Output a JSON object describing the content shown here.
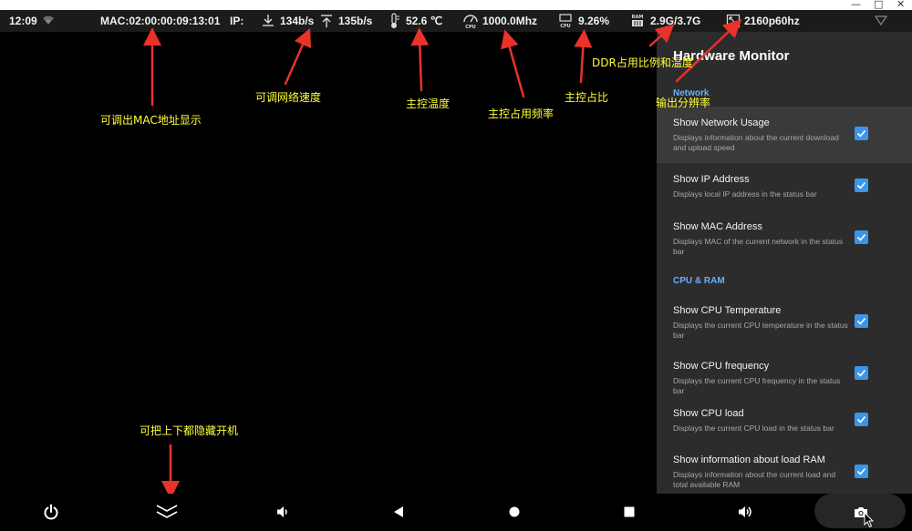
{
  "window": {
    "controls": {
      "minimize": "—",
      "maximize": "□",
      "close": "✕"
    }
  },
  "statusbar": {
    "time": "12:09",
    "mac": "MAC:02:00:00:09:13:01",
    "ip_label": "IP:",
    "download": "134b/s",
    "upload": "135b/s",
    "temperature": "52.6 ℃",
    "cpu_freq": "1000.0Mhz",
    "cpu_icon_label": "CPU",
    "cpu_load": "9.26%",
    "ram_icon_label": "RAM",
    "ram": "2.9G/3.7G",
    "resolution": "2160p60hz"
  },
  "annotations": {
    "mac": "可调出MAC地址显示",
    "network": "可调网络速度",
    "temperature": "主控温度",
    "frequency": "主控占用频率",
    "load": "主控占比",
    "ddr": "DDR占用比例和温度",
    "resolution": "输出分辨率",
    "hide": "可把上下都隐藏开机"
  },
  "panel": {
    "title": "Hardware Monitor",
    "sections": {
      "network": "Network",
      "cpu_ram": "CPU & RAM"
    },
    "items": [
      {
        "title": "Show Network Usage",
        "desc": "Displays information about the current download and upload speed",
        "checked": true
      },
      {
        "title": "Show IP Address",
        "desc": "Displays local IP address in the status bar",
        "checked": true
      },
      {
        "title": "Show MAC Address",
        "desc": "Displays MAC of the current network in the status bar",
        "checked": true
      },
      {
        "title": "Show CPU Temperature",
        "desc": "Displays the current CPU temperature in the status bar",
        "checked": true
      },
      {
        "title": "Show CPU frequency",
        "desc": "Displays the current CPU frequency in the status bar",
        "checked": true
      },
      {
        "title": "Show CPU load",
        "desc": "Displays the current CPU load in the status bar",
        "checked": true
      },
      {
        "title": "Show information about load RAM",
        "desc": "Displays information about the current load and total available RAM",
        "checked": true
      }
    ]
  },
  "colors": {
    "accent": "#3b96e8",
    "section": "#6ab0f7",
    "annotation": "#ffff3a",
    "arrow": "#e8322a"
  },
  "icons": {
    "wifi": "wifi-icon",
    "download": "download-arrow-icon",
    "upload": "upload-arrow-icon",
    "thermometer": "thermometer-icon",
    "cpu": "cpu-icon",
    "ram": "ram-icon",
    "resolution": "resolution-icon",
    "dropdown": "triangle-down-icon",
    "power": "power-icon",
    "hide": "double-chevron-down-icon",
    "vol_down": "volume-down-icon",
    "back": "back-icon",
    "home": "home-icon",
    "recents": "recents-icon",
    "vol_up": "volume-up-icon",
    "screenshot": "camera-icon"
  }
}
